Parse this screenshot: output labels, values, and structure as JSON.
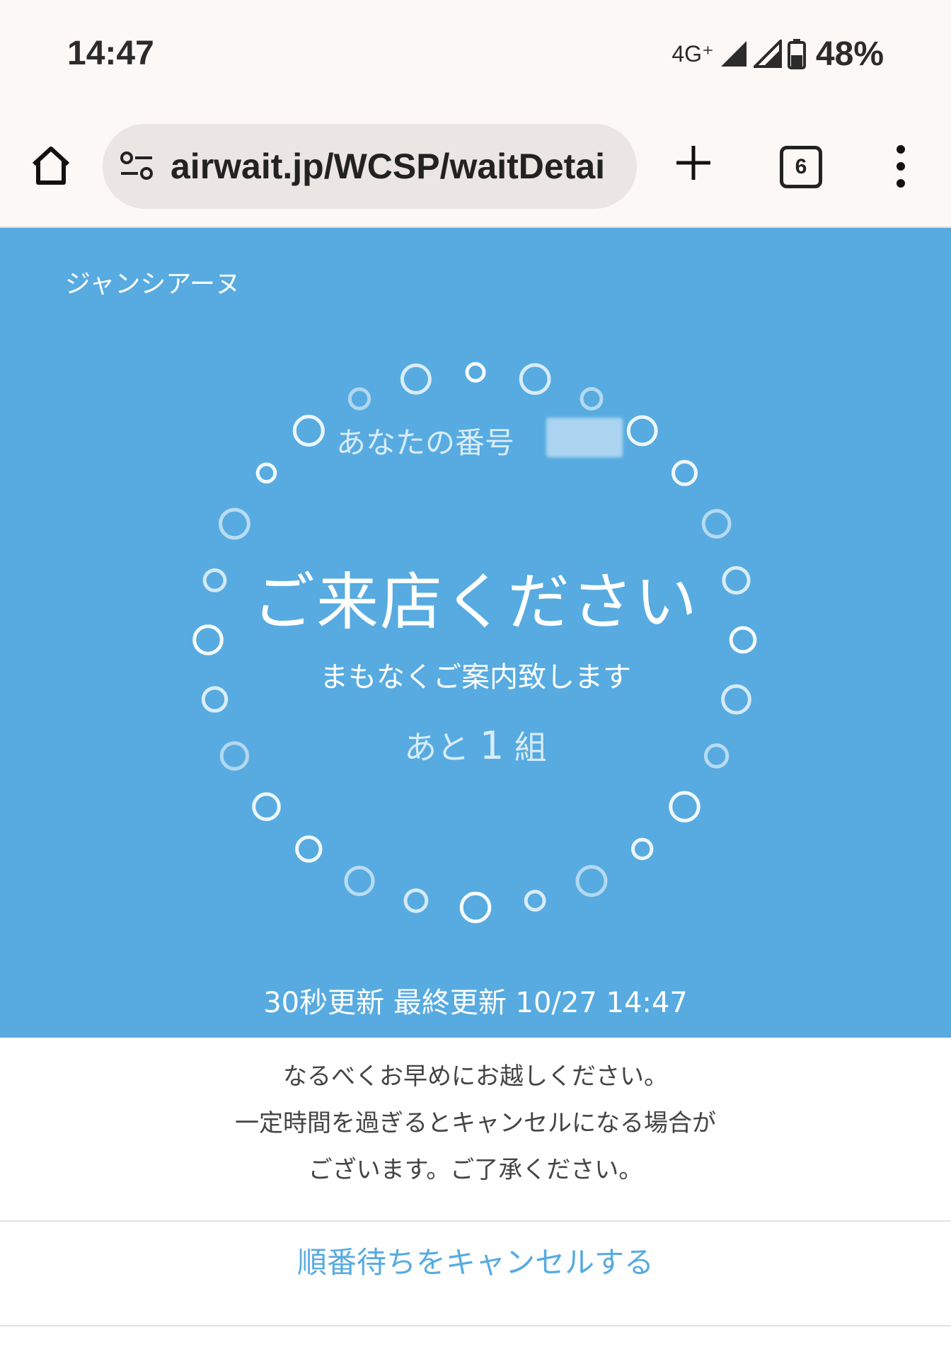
{
  "status_bar": {
    "time": "14:47",
    "network_label": "4G⁺",
    "battery": "48%",
    "icons": [
      "signal-icon",
      "signal-icon",
      "battery-icon"
    ]
  },
  "browser": {
    "url": "airwait.jp/WCSP/waitDetai",
    "tab_count": "6",
    "icons": [
      "home-icon",
      "site-info-icon",
      "plus-icon",
      "tabs-icon",
      "more-vert-icon"
    ]
  },
  "hero": {
    "shop_name": "ジャンシアーヌ",
    "your_number_label": "あなたの番号",
    "main_message": "ご来店ください",
    "sub_message": "まもなくご案内致します",
    "remaining_prefix": "あと",
    "remaining_count": "1",
    "remaining_suffix": "組",
    "update_info": "30秒更新 最終更新 10/27 14:47"
  },
  "notice": {
    "line1": "なるべくお早めにお越しください。",
    "line2": "一定時間を過ぎるとキャンセルになる場合が",
    "line3": "ございます。ご了承ください。"
  },
  "cancel_label": "順番待ちをキャンセルする",
  "colors": {
    "hero_bg": "#57abe0",
    "chrome_bg": "#fcf8f5",
    "link": "#57abe0"
  }
}
